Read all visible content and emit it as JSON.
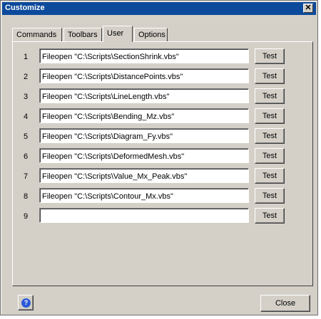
{
  "window": {
    "title": "Customize",
    "close_glyph": "✕"
  },
  "tabs": [
    {
      "label": "Commands",
      "active": false
    },
    {
      "label": "Toolbars",
      "active": false
    },
    {
      "label": "User",
      "active": true
    },
    {
      "label": "Options",
      "active": false
    }
  ],
  "rows": [
    {
      "num": "1",
      "value": "Fileopen \"C:\\Scripts\\SectionShrink.vbs\"",
      "button": "Test"
    },
    {
      "num": "2",
      "value": "Fileopen \"C:\\Scripts\\DistancePoints.vbs\"",
      "button": "Test"
    },
    {
      "num": "3",
      "value": "Fileopen \"C:\\Scripts\\LineLength.vbs\"",
      "button": "Test"
    },
    {
      "num": "4",
      "value": "Fileopen \"C:\\Scripts\\Bending_Mz.vbs\"",
      "button": "Test"
    },
    {
      "num": "5",
      "value": "Fileopen \"C:\\Scripts\\Diagram_Fy.vbs\"",
      "button": "Test"
    },
    {
      "num": "6",
      "value": "Fileopen \"C:\\Scripts\\DeformedMesh.vbs\"",
      "button": "Test"
    },
    {
      "num": "7",
      "value": "Fileopen \"C:\\Scripts\\Value_Mx_Peak.vbs\"",
      "button": "Test"
    },
    {
      "num": "8",
      "value": "Fileopen \"C:\\Scripts\\Contour_Mx.vbs\"",
      "button": "Test"
    },
    {
      "num": "9",
      "value": "",
      "button": "Test"
    }
  ],
  "footer": {
    "help_glyph": "?",
    "close_label": "Close"
  },
  "colors": {
    "titlebar": "#0c4a9c",
    "dialog": "#d4d0c8",
    "help_icon": "#2a5ad8"
  }
}
